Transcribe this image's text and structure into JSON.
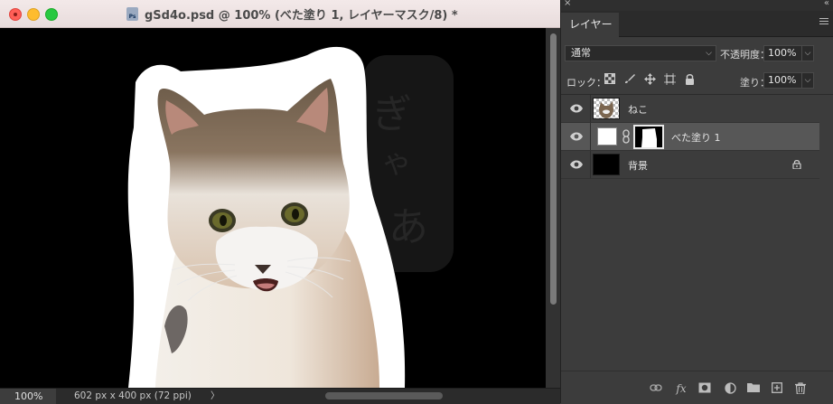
{
  "document": {
    "title": "gSd4o.psd @ 100% (べた塗り 1, レイヤーマスク/8) *",
    "file_icon_text": "Ps",
    "zoom": "100%",
    "doc_size": "602 px x 400 px (72 ppi)",
    "status_arrow": "〉",
    "canvas_text": [
      "ぎ",
      "ゃ",
      "あ"
    ]
  },
  "panel": {
    "tab_label": "レイヤー",
    "close_glyph": "×",
    "collapse_glyph": "«",
    "blend_mode": "通常",
    "opacity_label": "不透明度：",
    "opacity_value": "100%",
    "lock_label": "ロック：",
    "fill_label": "塗り：",
    "fill_value": "100%",
    "lock_icons": [
      "transparency-lock-icon",
      "brush-lock-icon",
      "move-lock-icon",
      "artboard-lock-icon",
      "padlock-icon"
    ],
    "layers": [
      {
        "name": "ねこ",
        "visible": true,
        "selected": false
      },
      {
        "name": "べた塗り 1",
        "visible": true,
        "selected": true
      },
      {
        "name": "背景",
        "visible": true,
        "selected": false,
        "locked": true
      }
    ],
    "footer_icons": [
      "link-icon",
      "fx-icon",
      "mask-icon",
      "adjustment-icon",
      "folder-icon",
      "new-layer-icon",
      "trash-icon"
    ],
    "footer_fx": "fx"
  },
  "colors": {
    "selected_row": "#575757",
    "panel_bg": "#3c3c3c",
    "canvas_bg": "#000000",
    "close": "#ff5f57",
    "minimize": "#febc2e",
    "maximize": "#28c840"
  }
}
